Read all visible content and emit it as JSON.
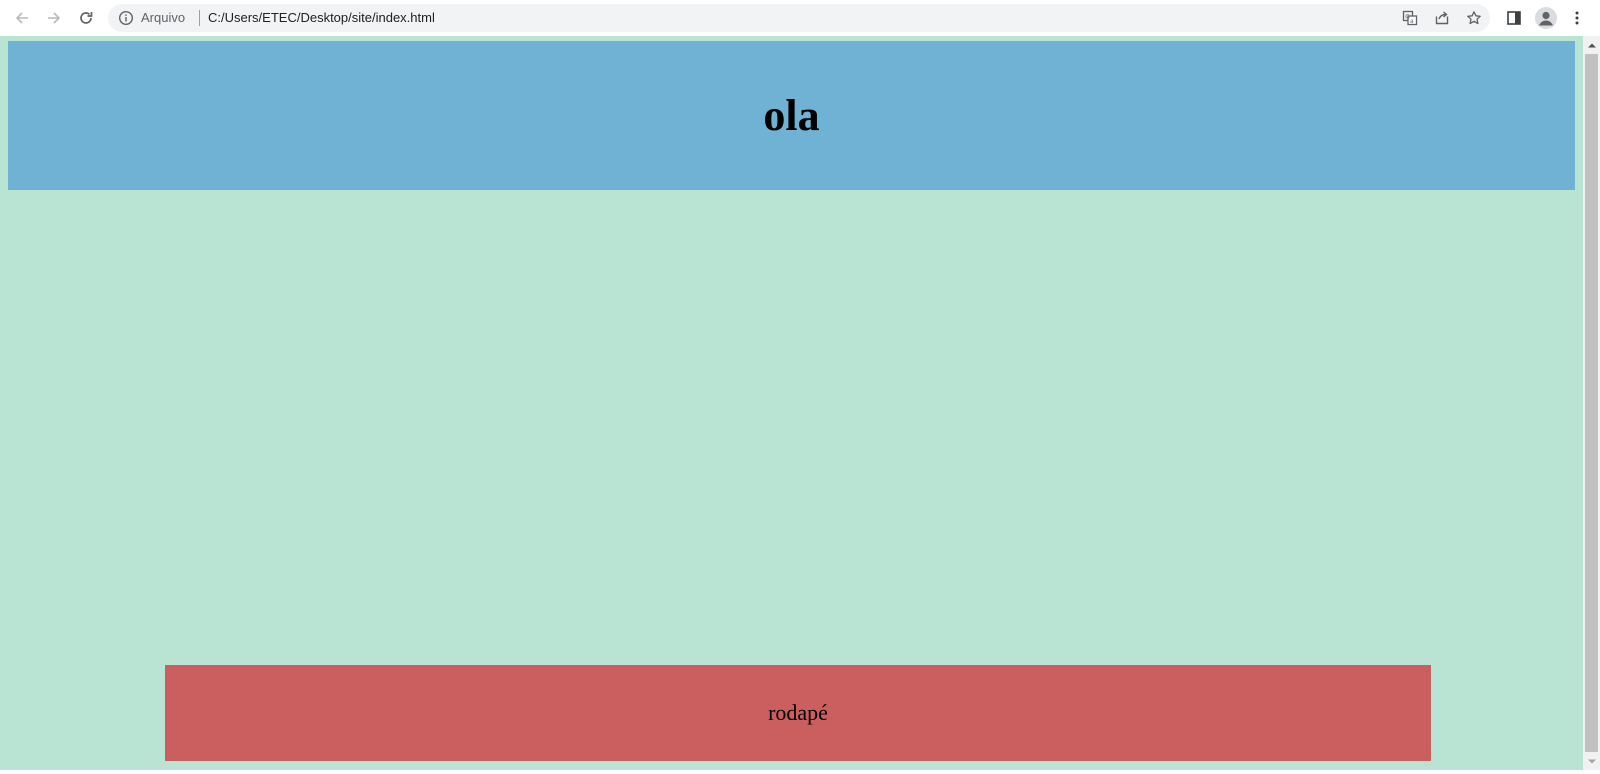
{
  "browser": {
    "address_bar": {
      "scheme_label": "Arquivo",
      "url": "C:/Users/ETEC/Desktop/site/index.html"
    },
    "icons": {
      "back": "back-arrow-icon",
      "forward": "forward-arrow-icon",
      "reload": "reload-icon",
      "info": "info-icon",
      "translate": "translate-icon",
      "share": "share-icon",
      "bookmark": "star-icon",
      "side_panel": "side-panel-icon",
      "profile": "profile-icon",
      "menu": "kebab-menu-icon"
    }
  },
  "page": {
    "header": {
      "heading": "ola",
      "background": "#70b2d4"
    },
    "footer": {
      "text": "rodapé",
      "background": "#cb5f5f"
    },
    "body_background": "#b9e3d2"
  }
}
